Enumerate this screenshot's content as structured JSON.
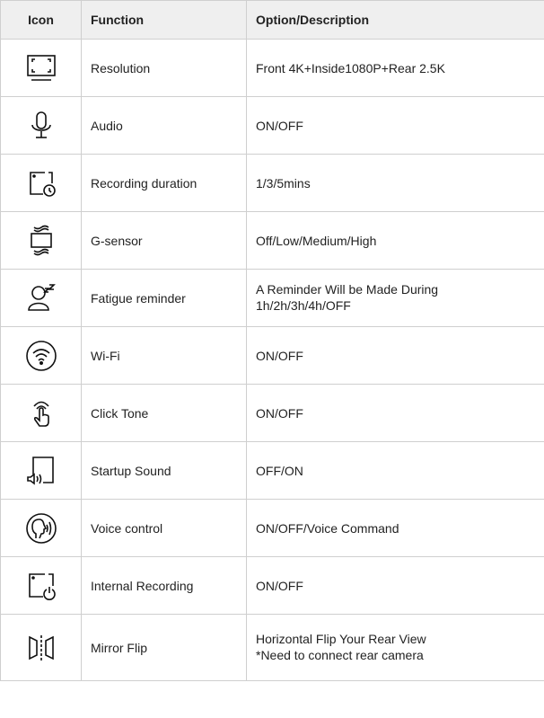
{
  "header": {
    "icon": "Icon",
    "function": "Function",
    "description": "Option/Description"
  },
  "rows": [
    {
      "icon": "resolution-frame-icon",
      "function": "Resolution",
      "description": "Front 4K+Inside1080P+Rear 2.5K"
    },
    {
      "icon": "microphone-icon",
      "function": "Audio",
      "description": "ON/OFF"
    },
    {
      "icon": "camera-clock-icon",
      "function": "Recording duration",
      "description": "1/3/5mins"
    },
    {
      "icon": "g-sensor-icon",
      "function": "G-sensor",
      "description": "Off/Low/Medium/High"
    },
    {
      "icon": "sleeping-person-icon",
      "function": "Fatigue reminder",
      "description": "A Reminder Will be Made During\n1h/2h/3h/4h/OFF"
    },
    {
      "icon": "wifi-icon",
      "function": "Wi-Fi",
      "description": "ON/OFF"
    },
    {
      "icon": "touch-hand-icon",
      "function": "Click Tone",
      "description": "ON/OFF"
    },
    {
      "icon": "speaker-frame-icon",
      "function": "Startup Sound",
      "description": "OFF/ON"
    },
    {
      "icon": "voice-face-icon",
      "function": "Voice control",
      "description": "ON/OFF/Voice Command"
    },
    {
      "icon": "camera-power-icon",
      "function": "Internal Recording",
      "description": "ON/OFF"
    },
    {
      "icon": "mirror-flip-icon",
      "function": "Mirror Flip",
      "description": "Horizontal Flip Your Rear View\n*Need to connect rear camera"
    }
  ]
}
